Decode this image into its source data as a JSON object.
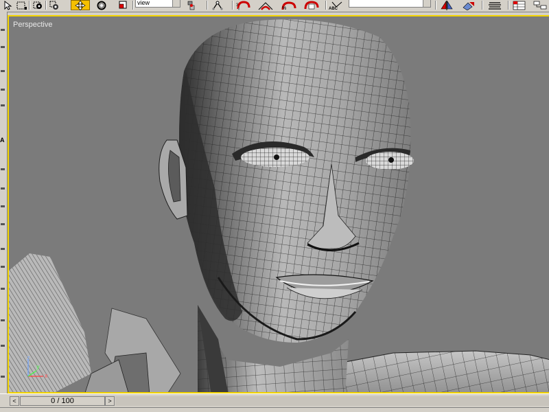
{
  "toolbar": {
    "view_select_value": "view",
    "selection_filter": "",
    "render_label": "ABC",
    "buttons": [
      {
        "name": "select-object-icon"
      },
      {
        "name": "select-region-icon"
      },
      {
        "name": "select-by-name-icon"
      },
      {
        "name": "select-and-move-icon",
        "active": true
      },
      {
        "name": "select-and-rotate-icon"
      },
      {
        "name": "select-and-scale-icon"
      },
      {
        "name": "use-pivot-center-icon"
      },
      {
        "name": "select-and-link-icon"
      },
      {
        "name": "snap-toggle-icon"
      },
      {
        "name": "angle-snap-icon"
      },
      {
        "name": "percent-snap-icon"
      },
      {
        "name": "spinner-snap-icon"
      },
      {
        "name": "spell-check-icon"
      },
      {
        "name": "mirror-icon"
      },
      {
        "name": "align-icon"
      },
      {
        "name": "layer-manager-icon"
      },
      {
        "name": "curve-editor-icon"
      },
      {
        "name": "schematic-view-icon"
      }
    ]
  },
  "viewport": {
    "label": "Perspective",
    "active_border_color": "#f3d400",
    "background_color": "#7b7b7b",
    "axis": {
      "x": "x",
      "y": "y",
      "z": "z"
    }
  },
  "timeslider": {
    "frame_display": "0 / 100",
    "prev_label": "<",
    "next_label": ">"
  },
  "colors": {
    "ui_gray": "#d4d0c8",
    "active_button": "#f5c000"
  }
}
